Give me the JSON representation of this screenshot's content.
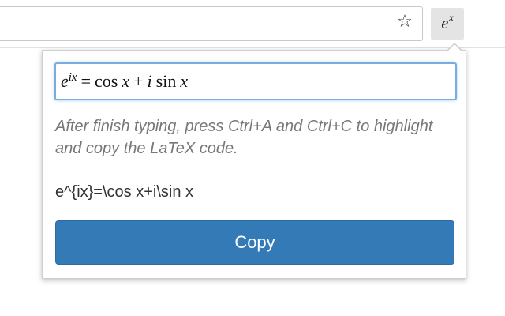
{
  "toolbar": {
    "star_glyph": "☆",
    "extension_base": "e",
    "extension_sup": "x"
  },
  "popup": {
    "math_field": {
      "e": "e",
      "exponent": "ix",
      "equals": "=",
      "cos": "cos",
      "x1": "x",
      "plus": "+",
      "i": "i",
      "sin": "sin",
      "x2": "x"
    },
    "help_text": "After finish typing, press Ctrl+A and Ctrl+C to highlight and copy the LaTeX code.",
    "latex_code": "e^{ix}=\\cos x+i\\sin x",
    "copy_label": "Copy"
  },
  "colors": {
    "primary": "#337ab7",
    "focus_border": "#7aaddb",
    "help_text": "#777777"
  }
}
